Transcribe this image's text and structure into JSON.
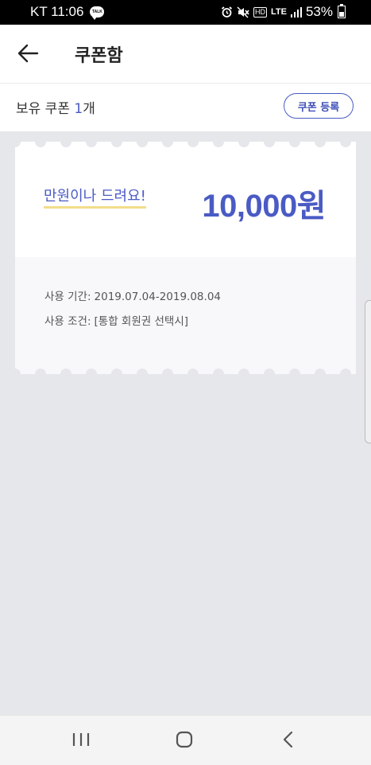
{
  "status_bar": {
    "carrier_time": "KT 11:06",
    "talk_badge": "TALK",
    "hd": "HD",
    "network": "LTE",
    "battery": "53%",
    "icons": [
      "kakaotalk-icon",
      "alarm-icon",
      "mute-icon",
      "hd-icon",
      "lte-icon",
      "signal-icon",
      "battery-icon"
    ]
  },
  "header": {
    "title": "쿠폰함",
    "back_icon": "back-arrow-icon"
  },
  "coupon_summary": {
    "prefix": "보유 쿠폰 ",
    "count": "1",
    "suffix": "개",
    "register_label": "쿠폰 등록"
  },
  "coupon": {
    "name": "만원이나 드려요!",
    "amount": "10,000원",
    "period_label": "사용 기간:",
    "period_value": "2019.07.04-2019.08.04",
    "condition_label": "사용 조건:",
    "condition_value": "[통합 회원권 선택시]"
  },
  "nav_bar": {
    "icons": [
      "recent-apps-icon",
      "home-icon",
      "back-icon"
    ]
  },
  "colors": {
    "accent": "#4a5bc4",
    "underline": "#f3dd8c",
    "background": "#e6e7ea"
  }
}
